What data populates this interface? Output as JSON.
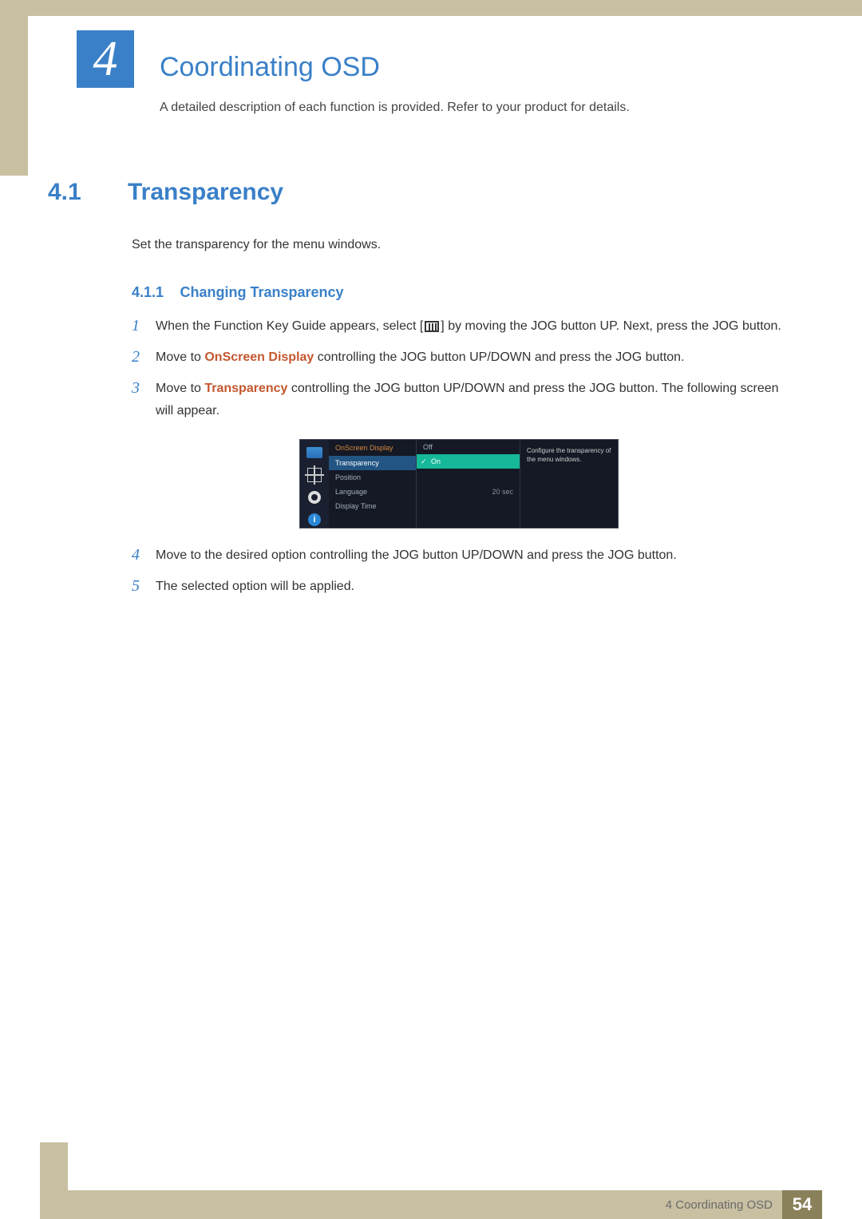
{
  "chapter": {
    "num": "4",
    "title": "Coordinating OSD",
    "intro": "A detailed description of each function is provided. Refer to your product for details."
  },
  "section": {
    "num": "4.1",
    "title": "Transparency",
    "text": "Set the transparency for the menu windows."
  },
  "subsection": {
    "num": "4.1.1",
    "title": "Changing Transparency"
  },
  "steps": {
    "s1a": "When the Function Key Guide appears, select [",
    "s1b": "] by moving the JOG button UP. Next, press the JOG button.",
    "s2a": "Move to ",
    "s2hl": "OnScreen Display",
    "s2b": " controlling the JOG button UP/DOWN and press the JOG button.",
    "s3a": "Move to ",
    "s3hl": "Transparency",
    "s3b": " controlling the JOG button UP/DOWN and press the JOG button. The following screen will appear.",
    "s4": "Move to the desired option controlling the JOG button UP/DOWN and press the JOG button.",
    "s5": "The selected option will be applied.",
    "n1": "1",
    "n2": "2",
    "n3": "3",
    "n4": "4",
    "n5": "5"
  },
  "osd": {
    "menu_title": "OnScreen Display",
    "items": {
      "transparency": "Transparency",
      "position": "Position",
      "language": "Language",
      "display_time": "Display Time"
    },
    "options": {
      "off": "Off",
      "on": "On"
    },
    "value": "20 sec",
    "desc": "Configure the transparency of the menu windows.",
    "info": "i"
  },
  "footer": {
    "label": "4 Coordinating OSD",
    "page": "54"
  }
}
